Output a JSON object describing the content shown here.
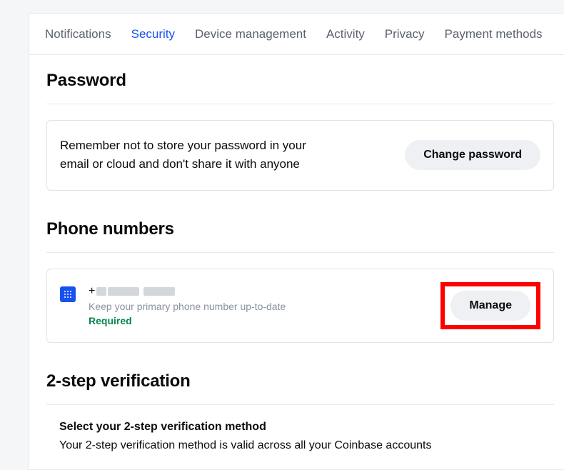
{
  "tabs": {
    "notifications": "Notifications",
    "security": "Security",
    "device_management": "Device management",
    "activity": "Activity",
    "privacy": "Privacy",
    "payment_methods": "Payment methods"
  },
  "password": {
    "title": "Password",
    "message": "Remember not to store your password in your email or cloud and don't share it with anyone",
    "button": "Change password"
  },
  "phone": {
    "title": "Phone numbers",
    "number_prefix": "+",
    "subtext": "Keep your primary phone number up-to-date",
    "required_label": "Required",
    "manage_button": "Manage"
  },
  "two_step": {
    "title": "2-step verification",
    "select_heading": "Select your 2-step verification method",
    "select_sub": "Your 2-step verification method is valid across all your Coinbase accounts"
  }
}
